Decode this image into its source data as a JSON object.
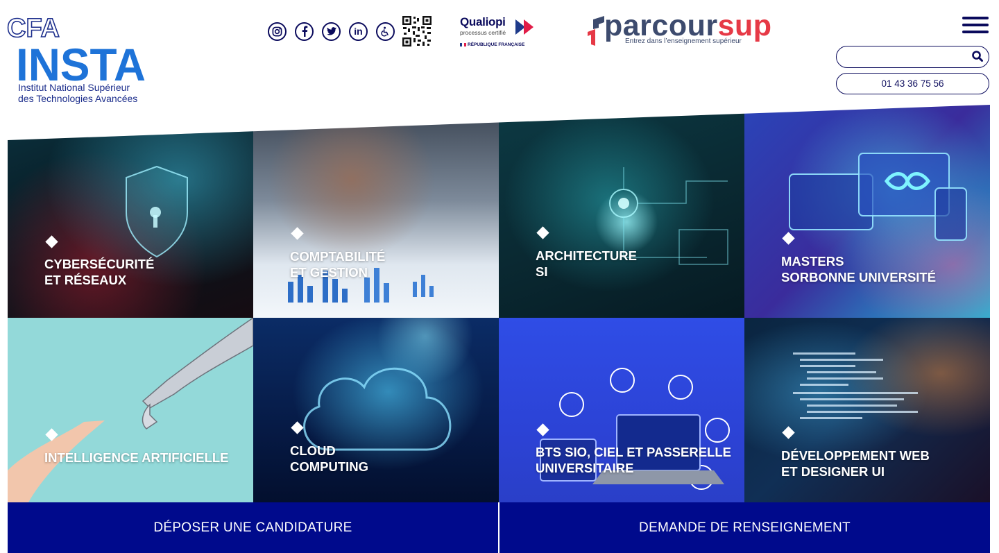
{
  "logo": {
    "top": "CFA",
    "main": "INSTA",
    "subtitle_line1": "Institut National Supérieur",
    "subtitle_line2": "des Technologies Avancées"
  },
  "socials": {
    "icons": [
      "instagram-icon",
      "facebook-icon",
      "twitter-icon",
      "linkedin-icon",
      "accessibility-icon",
      "qr-code-icon"
    ],
    "linkedin_text": "in"
  },
  "qualiopi": {
    "title": "Qualiopi",
    "subtitle": "processus certifié",
    "republic": "RÉPUBLIQUE FRANÇAISE"
  },
  "parcoursup": {
    "word_main": "parcour",
    "word_accent": "sup",
    "tagline": "Entrez dans l’enseignement supérieur"
  },
  "header": {
    "search_value": "",
    "phone": "01 43 36 75 56"
  },
  "tiles": [
    {
      "line1": "Cybersécurité",
      "line2": "et réseaux"
    },
    {
      "line1": "Comptabilité",
      "line2": "et gestion"
    },
    {
      "line1": "Architecture",
      "line2": "SI"
    },
    {
      "line1": "Masters",
      "line2": "Sorbonne Université"
    },
    {
      "line1": "Intelligence artificielle",
      "line2": ""
    },
    {
      "line1": "Cloud",
      "line2": "Computing"
    },
    {
      "line1": "BTS SIO, CIEL et passerelle",
      "line2": "universitaire"
    },
    {
      "line1": "Développement web",
      "line2": "et designer UI"
    }
  ],
  "cta": {
    "apply": "DÉPOSER UNE CANDIDATURE",
    "info": "DEMANDE DE RENSEIGNEMENT"
  },
  "colors": {
    "navy": "#000a8c",
    "logo_blue": "#1e73d8",
    "parcoursup_red": "#e63946"
  }
}
